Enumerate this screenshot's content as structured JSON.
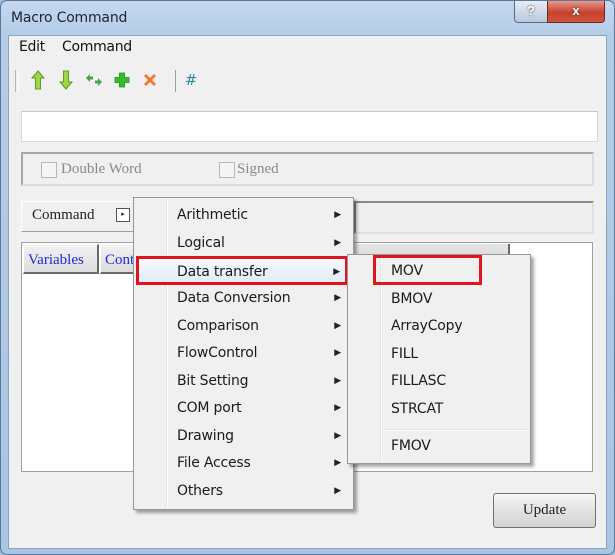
{
  "window": {
    "title": "Macro Command",
    "help_button_label": "?",
    "close_button_label": "x"
  },
  "menubar": {
    "items": [
      {
        "label": "Edit"
      },
      {
        "label": "Command"
      }
    ]
  },
  "toolbar": {
    "buttons": [
      {
        "icon": "arrow-up-icon",
        "tooltip": "Move up",
        "color": "#8cc63f"
      },
      {
        "icon": "arrow-down-icon",
        "tooltip": "Move down",
        "color": "#8cc63f"
      },
      {
        "icon": "swap-icon",
        "tooltip": "Swap",
        "color": "#4aa34a"
      },
      {
        "icon": "plus-icon",
        "tooltip": "Add",
        "color": "#2fbf2f"
      },
      {
        "icon": "delete-x-icon",
        "tooltip": "Delete",
        "color": "#f07a2c"
      },
      {
        "icon": "hash-icon",
        "glyph": "#",
        "color": "#2d8aa3"
      }
    ]
  },
  "expression_input": {
    "value": "",
    "placeholder": ""
  },
  "options": {
    "double_word": {
      "label": "Double Word",
      "checked": false
    },
    "signed": {
      "label": "Signed",
      "checked": false
    }
  },
  "command_row": {
    "label": "Command",
    "arrow_glyph": "▸"
  },
  "list": {
    "columns": [
      {
        "label": "Variables"
      },
      {
        "label": "Cont"
      }
    ]
  },
  "update_button": {
    "label": "Update"
  },
  "command_menu": {
    "items": [
      {
        "label": "Arithmetic",
        "has_submenu": true
      },
      {
        "label": "Logical",
        "has_submenu": true
      },
      {
        "label": "Data transfer",
        "has_submenu": true,
        "highlighted": true
      },
      {
        "label": "Data Conversion",
        "has_submenu": true
      },
      {
        "label": "Comparison",
        "has_submenu": true
      },
      {
        "label": "FlowControl",
        "has_submenu": true
      },
      {
        "label": "Bit Setting",
        "has_submenu": true
      },
      {
        "label": "COM port",
        "has_submenu": true
      },
      {
        "label": "Drawing",
        "has_submenu": true
      },
      {
        "label": "File Access",
        "has_submenu": true
      },
      {
        "label": "Others",
        "has_submenu": true
      }
    ],
    "submenu_arrow": "▶"
  },
  "data_transfer_submenu": {
    "items": [
      {
        "label": "MOV",
        "highlighted": true
      },
      {
        "label": "BMOV"
      },
      {
        "label": "ArrayCopy"
      },
      {
        "label": "FILL"
      },
      {
        "label": "FILLASC"
      },
      {
        "label": "STRCAT"
      },
      {
        "label": "FMOV"
      }
    ]
  },
  "colors": {
    "highlight_box": "#e0141e",
    "column_header_text": "#1d2bd6"
  }
}
